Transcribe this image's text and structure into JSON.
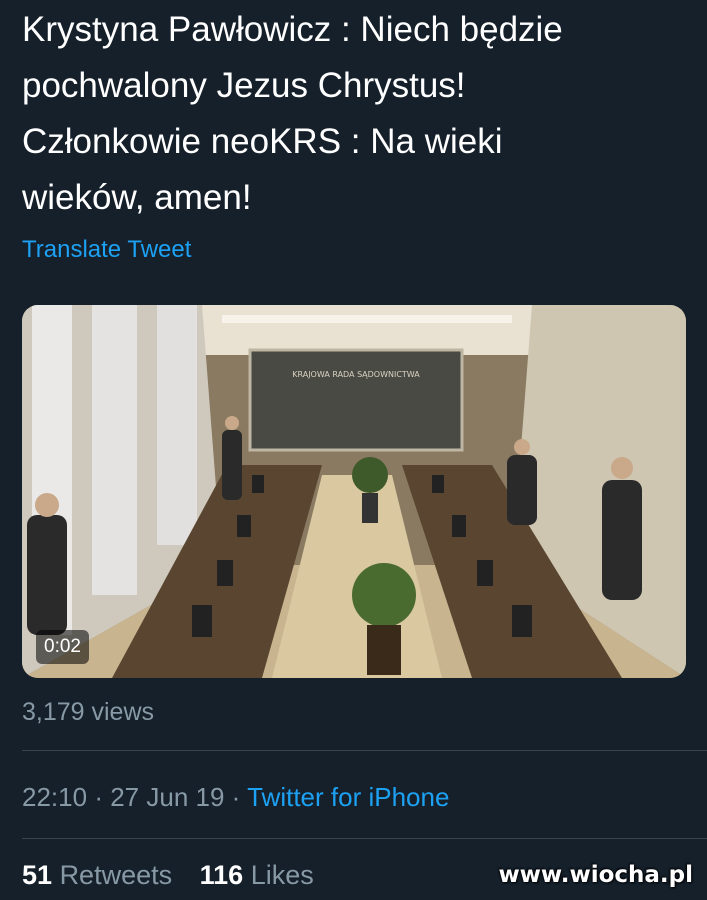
{
  "tweet": {
    "text": "Krystyna Pawłowicz : Niech będzie\npochwalony Jezus Chrystus!\nCzłonkowie neoKRS : Na wieki\nwieków, amen!",
    "translate_label": "Translate Tweet"
  },
  "media": {
    "duration": "0:02",
    "wall_sign": "KRAJOWA RADA SĄDOWNICTWA"
  },
  "views": "3,179 views",
  "meta": {
    "time": "22:10",
    "separator1": "·",
    "date": "27 Jun 19",
    "separator2": "·",
    "source": "Twitter for iPhone"
  },
  "stats": {
    "retweets_count": "51",
    "retweets_label": "Retweets",
    "likes_count": "116",
    "likes_label": "Likes"
  },
  "watermark": "www.wiocha.pl",
  "colors": {
    "background": "#15202b",
    "accent": "#1da1f2",
    "secondary_text": "#8899a6"
  }
}
